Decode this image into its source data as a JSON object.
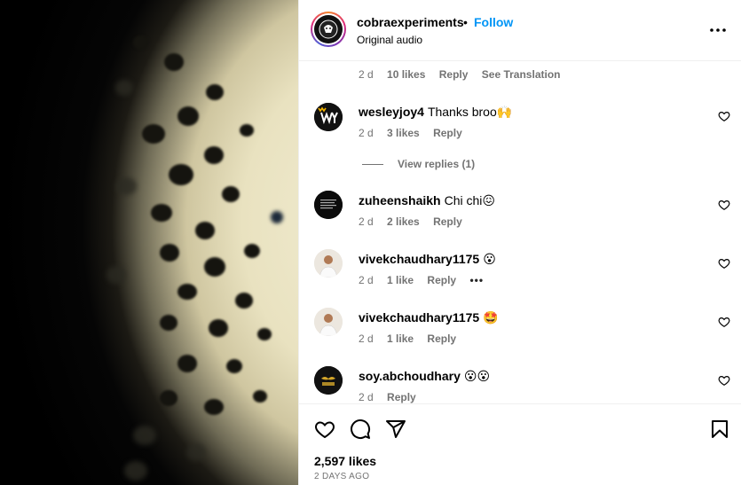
{
  "header": {
    "username": "cobraexperiments",
    "separator": "•",
    "follow_label": "Follow",
    "subtitle": "Original audio",
    "avatar_text": "COBRA"
  },
  "top_meta": {
    "time": "2 d",
    "likes": "10 likes",
    "reply": "Reply",
    "see_translation": "See Translation"
  },
  "comments": [
    {
      "username": "wesleyjoy4",
      "text": "Thanks broo",
      "emoji": "🙌",
      "time": "2 d",
      "likes": "3 likes",
      "reply": "Reply",
      "avatar_text": "W"
    },
    {
      "username": "zuheenshaikh",
      "text": "Chi chi",
      "emoji": "😖",
      "time": "2 d",
      "likes": "2 likes",
      "reply": "Reply"
    },
    {
      "username": "vivekchaudhary1175",
      "text": "",
      "emoji": "😮",
      "time": "2 d",
      "likes": "1 like",
      "reply": "Reply",
      "more": "•••"
    },
    {
      "username": "vivekchaudhary1175",
      "text": "",
      "emoji": "🤩",
      "time": "2 d",
      "likes": "1 like",
      "reply": "Reply"
    },
    {
      "username": "soy.abchoudhary",
      "text": "",
      "emoji": "😮😮",
      "time": "2 d",
      "likes": "",
      "reply": "Reply"
    }
  ],
  "view_replies": "View replies (1)",
  "footer": {
    "likes": "2,597 likes",
    "date": "2 DAYS AGO"
  },
  "colors": {
    "accent": "#0095f6",
    "muted": "#737373",
    "border": "#efefef"
  }
}
